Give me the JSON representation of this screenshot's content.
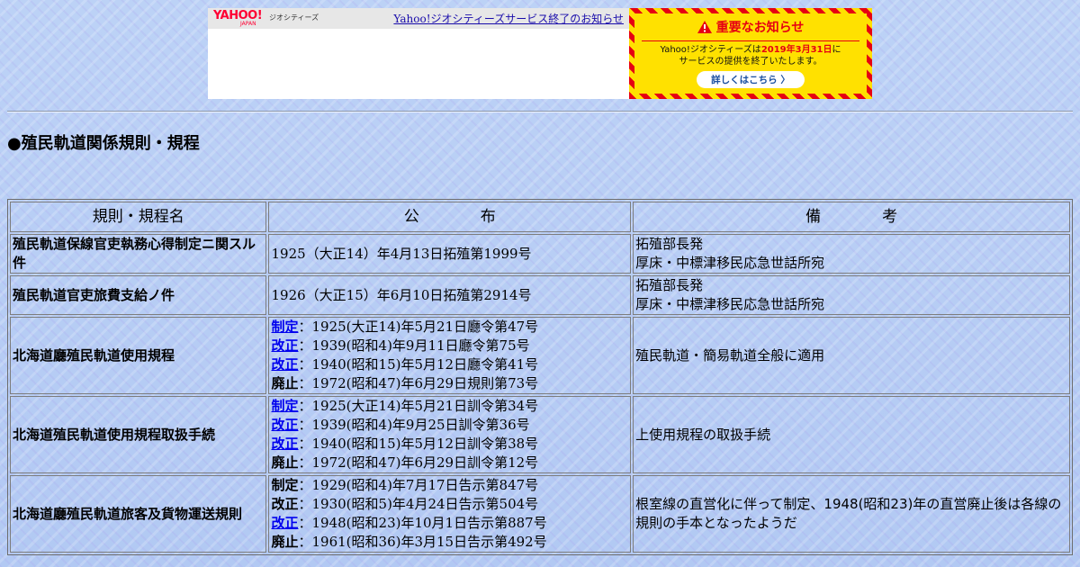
{
  "ad": {
    "logo": "YAHOO!",
    "logo_sub": "JAPAN",
    "geo_label": "ジオシティーズ",
    "link_text": "Yahoo!ジオシティーズサービス終了のお知らせ",
    "notice_title": "重要なお知らせ",
    "notice_line1_pre": "Yahoo!ジオシティーズは",
    "notice_date": "2019年3月31日",
    "notice_line1_post": "に",
    "notice_line2": "サービスの提供を終了いたします。",
    "notice_button": "詳しくはこちら 〉"
  },
  "page": {
    "title": "●殖民軌道関係規則・規程"
  },
  "table": {
    "headers": [
      "規則・規程名",
      "公　　　　布",
      "備　　　　考"
    ],
    "rows": [
      {
        "name": "殖民軌道保線官吏執務心得制定ニ関スル件",
        "size": "small",
        "pubs": [
          {
            "kw": "",
            "link": false,
            "text": "1925（大正14）年4月13日拓殖第1999号"
          }
        ],
        "notes": [
          "拓殖部長発",
          "厚床・中標津移民応急世話所宛"
        ]
      },
      {
        "name": "殖民軌道官吏旅費支給ノ件",
        "size": "small",
        "pubs": [
          {
            "kw": "",
            "link": false,
            "text": "1926（大正15）年6月10日拓殖第2914号"
          }
        ],
        "notes": [
          "拓殖部長発",
          "厚床・中標津移民応急世話所宛"
        ]
      },
      {
        "name": "北海道廳殖民軌道使用規程",
        "size": "big",
        "pubs": [
          {
            "kw": "制定",
            "link": true,
            "text": "：1925(大正14)年5月21日廳令第47号"
          },
          {
            "kw": "改正",
            "link": true,
            "text": "：1939(昭和4)年9月11日廳令第75号"
          },
          {
            "kw": "改正",
            "link": true,
            "text": "：1940(昭和15)年5月12日廳令第41号"
          },
          {
            "kw": "廃止",
            "link": false,
            "text": "：1972(昭和47)年6月29日規則第73号"
          }
        ],
        "notes": [
          "殖民軌道・簡易軌道全般に適用"
        ]
      },
      {
        "name": "北海道殖民軌道使用規程取扱手続",
        "size": "big",
        "pubs": [
          {
            "kw": "制定",
            "link": true,
            "text": "：1925(大正14)年5月21日訓令第34号"
          },
          {
            "kw": "改正",
            "link": true,
            "text": "：1939(昭和4)年9月25日訓令第36号"
          },
          {
            "kw": "改正",
            "link": true,
            "text": "：1940(昭和15)年5月12日訓令第38号"
          },
          {
            "kw": "廃止",
            "link": false,
            "text": "：1972(昭和47)年6月29日訓令第12号"
          }
        ],
        "notes": [
          "上使用規程の取扱手続"
        ]
      },
      {
        "name": "北海道廳殖民軌道旅客及貨物運送規則",
        "size": "big",
        "pubs": [
          {
            "kw": "制定",
            "link": false,
            "text": "：1929(昭和4)年7月17日告示第847号"
          },
          {
            "kw": "改正",
            "link": false,
            "text": "：1930(昭和5)年4月24日告示第504号"
          },
          {
            "kw": "改正",
            "link": true,
            "text": "：1948(昭和23)年10月1日告示第887号"
          },
          {
            "kw": "廃止",
            "link": false,
            "text": "：1961(昭和36)年3月15日告示第492号"
          }
        ],
        "notes": [
          "根室線の直営化に伴って制定、1948(昭和23)年の直営廃止後は各線の規則の手本となったようだ"
        ]
      }
    ]
  }
}
